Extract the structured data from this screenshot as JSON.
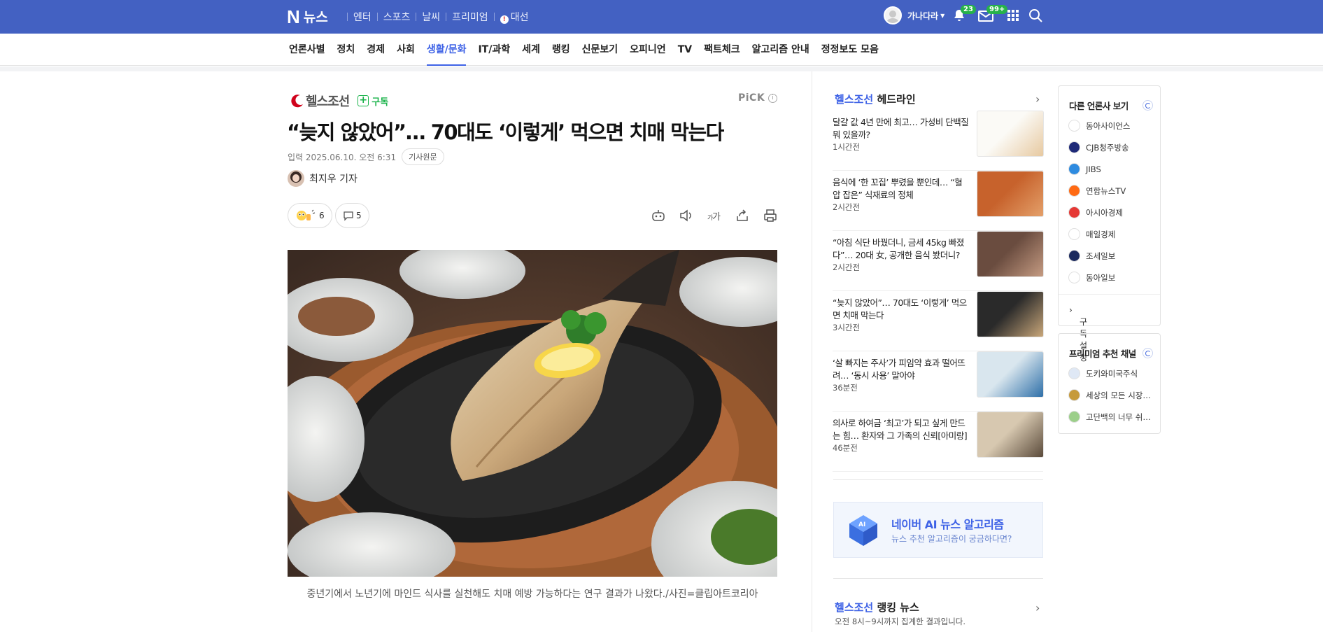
{
  "topbar": {
    "logo_n": "N",
    "logo_text": "뉴스",
    "nav": [
      "엔터",
      "스포츠",
      "날씨",
      "프리미엄"
    ],
    "election": "대선",
    "user_name": "가나다라",
    "notif_count": "23",
    "mail_count": "99+"
  },
  "categories": [
    "언론사별",
    "정치",
    "경제",
    "사회",
    "생활/문화",
    "IT/과학",
    "세계",
    "랭킹",
    "신문보기",
    "오피니언",
    "TV",
    "팩트체크",
    "알고리즘 안내",
    "정정보도 모음"
  ],
  "active_category": "생활/문화",
  "article": {
    "press_name": "헬스조선",
    "subscribe_label": "구독",
    "pick_label": "PiCK",
    "headline": "“늦지 않았어”… 70대도 ‘이렇게’ 먹으면 치매 막는다",
    "date": "입력 2025.06.10. 오전 6:31",
    "original_button": "기사원문",
    "reporter": "최지우 기자",
    "reaction_count": "6",
    "comment_count": "5",
    "caption": "중년기에서 노년기에 마인드 식사를 실천해도 치매 예방 가능하다는 연구 결과가 나왔다./사진=클립아트코리아"
  },
  "headlines": {
    "press": "헬스조선",
    "label": "헤드라인",
    "items": [
      {
        "title": "달걀 값 4년 만에 최고… 가성비 단백질 뭐 있을까?",
        "time": "1시간전"
      },
      {
        "title": "음식에 ‘한 꼬집’ 뿌렸을 뿐인데… “혈압 잡은” 식재료의 정체",
        "time": "2시간전"
      },
      {
        "title": "“아침 식단 바꿨더니, 금세 45kg 빠졌다”… 20대 女, 공개한 음식 봤더니?",
        "time": "2시간전"
      },
      {
        "title": "“늦지 않았어”… 70대도 ‘이렇게’ 먹으면 치매 막는다",
        "time": "3시간전"
      },
      {
        "title": "‘살 빠지는 주사’가 피임약 효과 떨어뜨려… ‘동시 사용’ 말아야",
        "time": "36분전"
      },
      {
        "title": "의사로 하여금 ‘최고’가 되고 싶게 만드는 힘… 환자와 그 가족의 신뢰[아미랑]",
        "time": "46분전"
      }
    ]
  },
  "ai_promo": {
    "icon_text": "AI",
    "title": "네이버 AI 뉴스 알고리즘",
    "subtitle": "뉴스 추천 알고리즘이 궁금하다면?"
  },
  "ranking": {
    "press": "헬스조선",
    "label": "랭킹 뉴스",
    "subtitle": "오전 8시~9시까지 집계한 결과입니다."
  },
  "other_press": {
    "title": "다른 언론사 보기",
    "items": [
      "동아사이언스",
      "CJB청주방송",
      "JIBS",
      "연합뉴스TV",
      "아시아경제",
      "매일경제",
      "조세일보",
      "동아일보"
    ],
    "footer": "구독 설정"
  },
  "premium": {
    "title": "프리미엄 추천 채널",
    "items": [
      "도키와미국주식",
      "세상의 모든 시장…",
      "고단백의 너무 쉬…"
    ]
  },
  "colors": {
    "brand": "#4361c2",
    "accent": "#3e62e6",
    "subscribe": "#1ab34a",
    "press": "#d0021b"
  }
}
